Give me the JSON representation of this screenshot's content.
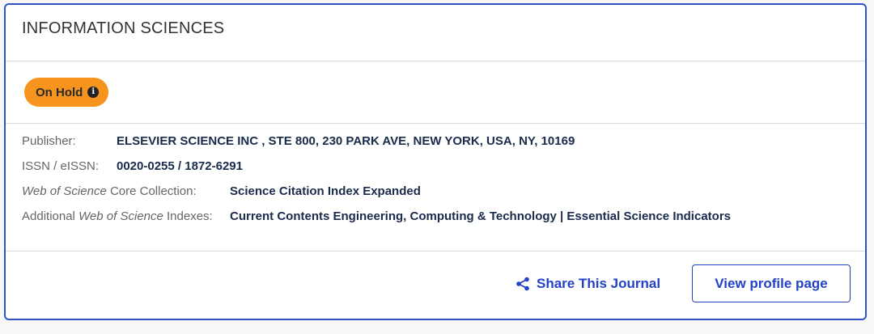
{
  "journal": {
    "title": "INFORMATION SCIENCES"
  },
  "status": {
    "label": "On Hold",
    "info_icon": "info-icon",
    "color": "#f7941d"
  },
  "details": {
    "publisher_label": "Publisher:",
    "publisher_value": "ELSEVIER SCIENCE INC , STE 800, 230 PARK AVE, NEW YORK, USA, NY, 10169",
    "issn_label": "ISSN / eISSN:",
    "issn_value": "0020-0255 / 1872-6291",
    "core_label_italic": "Web of Science",
    "core_label_rest": " Core Collection:",
    "core_value": "Science Citation Index Expanded",
    "additional_label_prefix": "Additional ",
    "additional_label_italic": "Web of Science",
    "additional_label_suffix": " Indexes:",
    "additional_value": "Current Contents Engineering, Computing & Technology | Essential Science Indicators"
  },
  "actions": {
    "share_label": "Share This Journal",
    "share_icon": "share-icon",
    "view_profile_label": "View profile page"
  },
  "colors": {
    "accent": "#2442c6",
    "border": "#2f54c8"
  }
}
